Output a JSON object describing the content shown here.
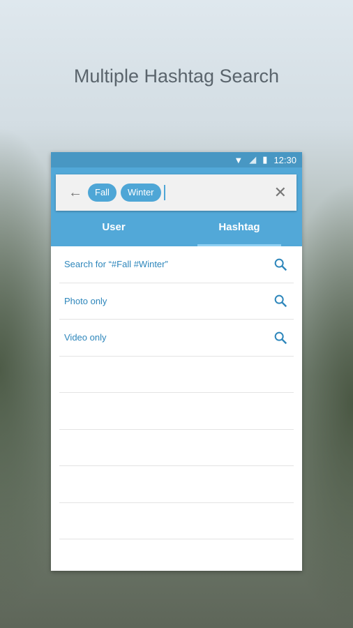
{
  "headline": "Multiple Hashtag Search",
  "status": {
    "time": "12:30"
  },
  "search": {
    "chips": [
      "Fall",
      "Winter"
    ]
  },
  "tabs": [
    {
      "label": "User"
    },
    {
      "label": "Hashtag",
      "active": true
    }
  ],
  "results": [
    {
      "label": "Search for “#Fall #Winter”"
    },
    {
      "label": "Photo only"
    },
    {
      "label": "Video only"
    }
  ],
  "colors": {
    "accent": "#52a8d8",
    "link": "#2d86bb"
  }
}
